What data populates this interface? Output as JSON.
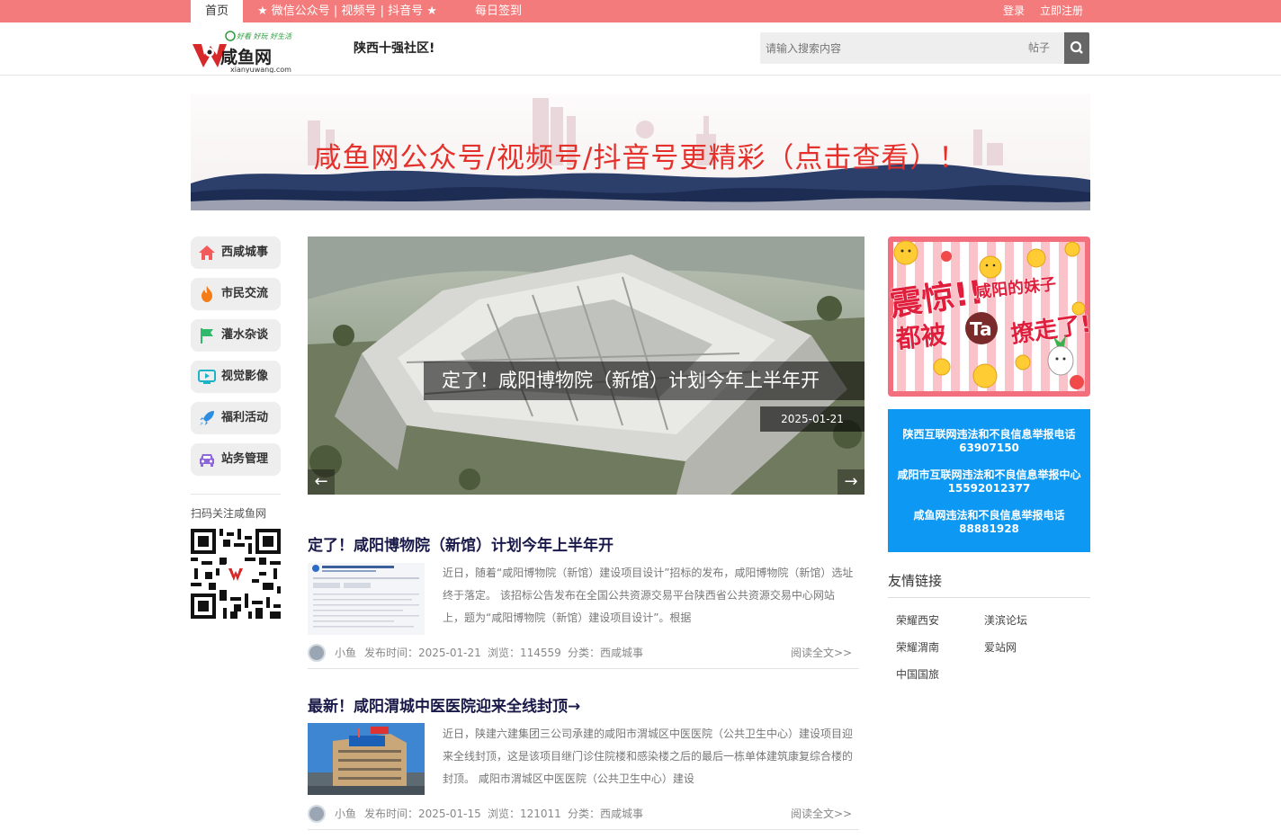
{
  "topbar": {
    "home": "首页",
    "nav1": "★ 微信公众号 | 视频号 | 抖音号 ★",
    "nav2": "每日签到",
    "login": "登录",
    "register": "立即注册"
  },
  "header": {
    "logo_top": "好看 好玩 好生活",
    "logo_main": "咸鱼网",
    "logo_url": "xianyuwang.com",
    "slogan": "陕西十强社区!",
    "search_placeholder": "请输入搜索内容",
    "search_type": "帖子"
  },
  "banner": {
    "text": "咸鱼网公众号/视频号/抖音号更精彩（点击查看）！"
  },
  "leftnav": {
    "items": [
      {
        "label": "西咸城事",
        "icon": "house-icon",
        "color": "#f25b5b"
      },
      {
        "label": "市民交流",
        "icon": "flame-icon",
        "color": "#f57d18"
      },
      {
        "label": "灌水杂谈",
        "icon": "flag-icon",
        "color": "#2fb96b"
      },
      {
        "label": "视觉影像",
        "icon": "video-icon",
        "color": "#1cb3c7"
      },
      {
        "label": "福利活动",
        "icon": "rocket-icon",
        "color": "#2e8de0"
      },
      {
        "label": "站务管理",
        "icon": "car-icon",
        "color": "#8e67d9"
      }
    ],
    "qr_label": "扫码关注咸鱼网"
  },
  "slider": {
    "caption": "定了！咸阳博物院（新馆）计划今年上半年开",
    "date": "2025-01-21",
    "prev": "←",
    "next": "→"
  },
  "posts": [
    {
      "title": "定了！咸阳博物院（新馆）计划今年上半年开",
      "excerpt": "近日，随着“咸阳博物院（新馆）建设项目设计”招标的发布，咸阳博物院（新馆）选址终于落定。 该招标公告发布在全国公共资源交易平台陕西省公共资源交易中心网站上，题为“咸阳博物院（新馆）建设项目设计”。根据",
      "author": "小鱼",
      "date": "发布时间：2025-01-21",
      "views": "浏览：114559",
      "category": "分类：西咸城事",
      "more": "阅读全文>>"
    },
    {
      "title": "最新！咸阳渭城中医医院迎来全线封顶→",
      "excerpt": "近日，陕建六建集团三公司承建的咸阳市渭城区中医医院（公共卫生中心）建设项目迎来全线封顶，这是该项目继门诊住院楼和感染楼之后的最后一栋单体建筑康复综合楼的封顶。 咸阳市渭城区中医医院（公共卫生中心）建设",
      "author": "小鱼",
      "date": "发布时间：2025-01-15",
      "views": "浏览：121011",
      "category": "分类：西咸城事",
      "more": "阅读全文>>"
    }
  ],
  "sidebar": {
    "ad_line1": "震惊!!",
    "ad_line2": "咸阳的妹子",
    "ad_line3": "都被",
    "ad_ta": "Ta",
    "ad_line4": "撩走了!!",
    "report": [
      {
        "name": "陕西互联网违法和不良信息举报电话",
        "phone": "63907150"
      },
      {
        "name": "咸阳市互联网违法和不良信息举报中心",
        "phone": "15592012377"
      },
      {
        "name": "咸鱼网违法和不良信息举报电话",
        "phone": "88881928"
      }
    ],
    "friend_title": "友情链接",
    "friends": [
      "荣耀西安",
      "渼滨论坛",
      "荣耀渭南",
      "爱站网",
      "中国国旅"
    ]
  }
}
